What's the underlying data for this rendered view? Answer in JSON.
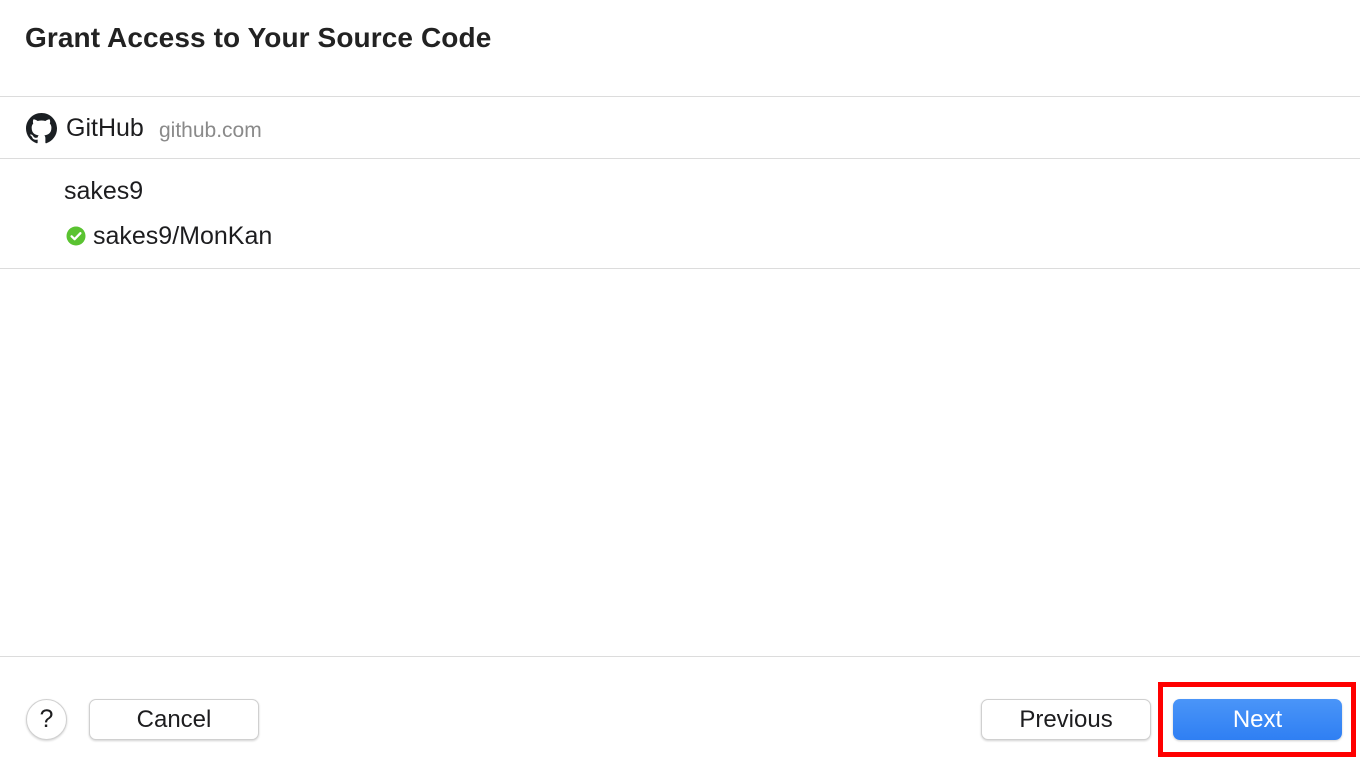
{
  "dialog": {
    "title": "Grant Access to Your Source Code"
  },
  "provider": {
    "name": "GitHub",
    "host": "github.com",
    "icon": "github-icon"
  },
  "account": {
    "name": "sakes9",
    "repositories": [
      {
        "name": "sakes9/MonKan",
        "status_icon": "check-circle-icon",
        "status_color": "#5ac331"
      }
    ]
  },
  "footer": {
    "help_label": "?",
    "cancel_label": "Cancel",
    "previous_label": "Previous",
    "next_label": "Next"
  },
  "colors": {
    "accent": "#2f7ff3",
    "highlight": "#ff0000"
  }
}
